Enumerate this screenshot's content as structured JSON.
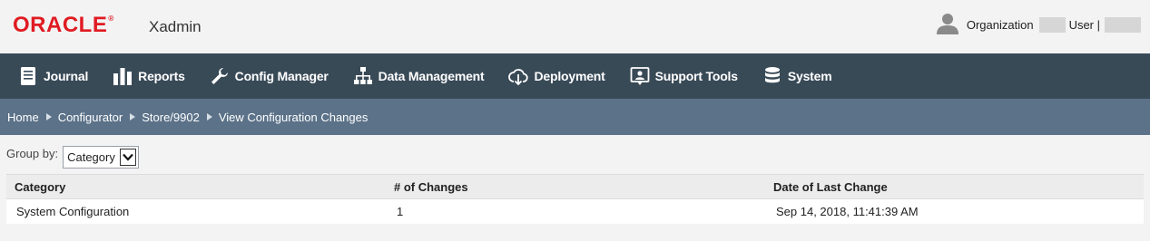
{
  "header": {
    "logo": "ORACLE",
    "trademark": "®",
    "app_name": "Xadmin",
    "organization_label": "Organization",
    "user_label": "User |"
  },
  "nav": [
    {
      "label": "Journal",
      "icon": "journal-icon"
    },
    {
      "label": "Reports",
      "icon": "reports-icon"
    },
    {
      "label": "Config Manager",
      "icon": "wrench-icon"
    },
    {
      "label": "Data Management",
      "icon": "hierarchy-icon"
    },
    {
      "label": "Deployment",
      "icon": "cloud-download-icon"
    },
    {
      "label": "Support Tools",
      "icon": "support-icon"
    },
    {
      "label": "System",
      "icon": "database-icon"
    }
  ],
  "breadcrumb": [
    "Home",
    "Configurator",
    "Store/9902",
    "View Configuration Changes"
  ],
  "group_by": {
    "label": "Group by:",
    "value": "Category"
  },
  "table": {
    "columns": [
      "Category",
      "# of Changes",
      "Date of Last Change"
    ],
    "rows": [
      [
        "System Configuration",
        "1",
        "Sep 14, 2018, 11:41:39 AM"
      ]
    ]
  },
  "colors": {
    "brand_red": "#e01b22",
    "nav_bg": "#394a57",
    "breadcrumb_bg": "#5b7289"
  }
}
